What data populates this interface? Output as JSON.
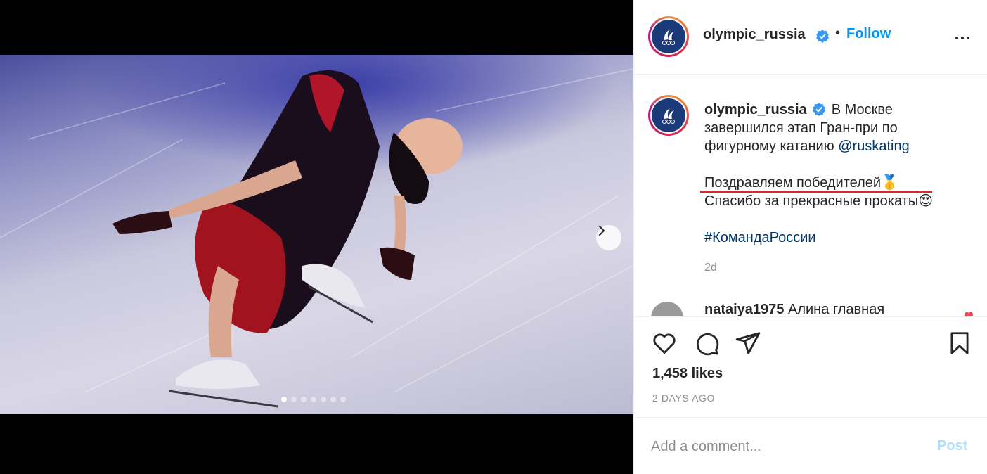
{
  "post": {
    "username": "olympic_russia",
    "follow_label": "Follow",
    "separator": "•",
    "caption_text_1": "В Москве завершился этап Гран-при по фигурному катанию",
    "caption_mention": "@ruskating",
    "caption_line_2": "Поздравляем победителей",
    "caption_emoji_1": "🥇",
    "caption_line_3": "Спасибо за прекрасные прокаты",
    "caption_emoji_2": "😍",
    "caption_hashtag": "#КомандаРоссии",
    "caption_time": "2d",
    "next_comment_user": "nataiya1975",
    "next_comment_text": "Алина главная",
    "likes": "1,458 likes",
    "time_ago": "2 DAYS AGO",
    "comment_placeholder": "Add a comment...",
    "post_label": "Post"
  },
  "carousel": {
    "slide_count": 7,
    "active_index": 0
  },
  "colors": {
    "follow": "#0095f6",
    "post_disabled": "#b2dffc",
    "underline": "#e0262b",
    "verified": "#3897f0"
  },
  "icons": [
    "verified-badge-icon",
    "more-options-icon",
    "heart-icon",
    "comment-icon",
    "share-icon",
    "bookmark-icon",
    "chevron-right-icon"
  ]
}
